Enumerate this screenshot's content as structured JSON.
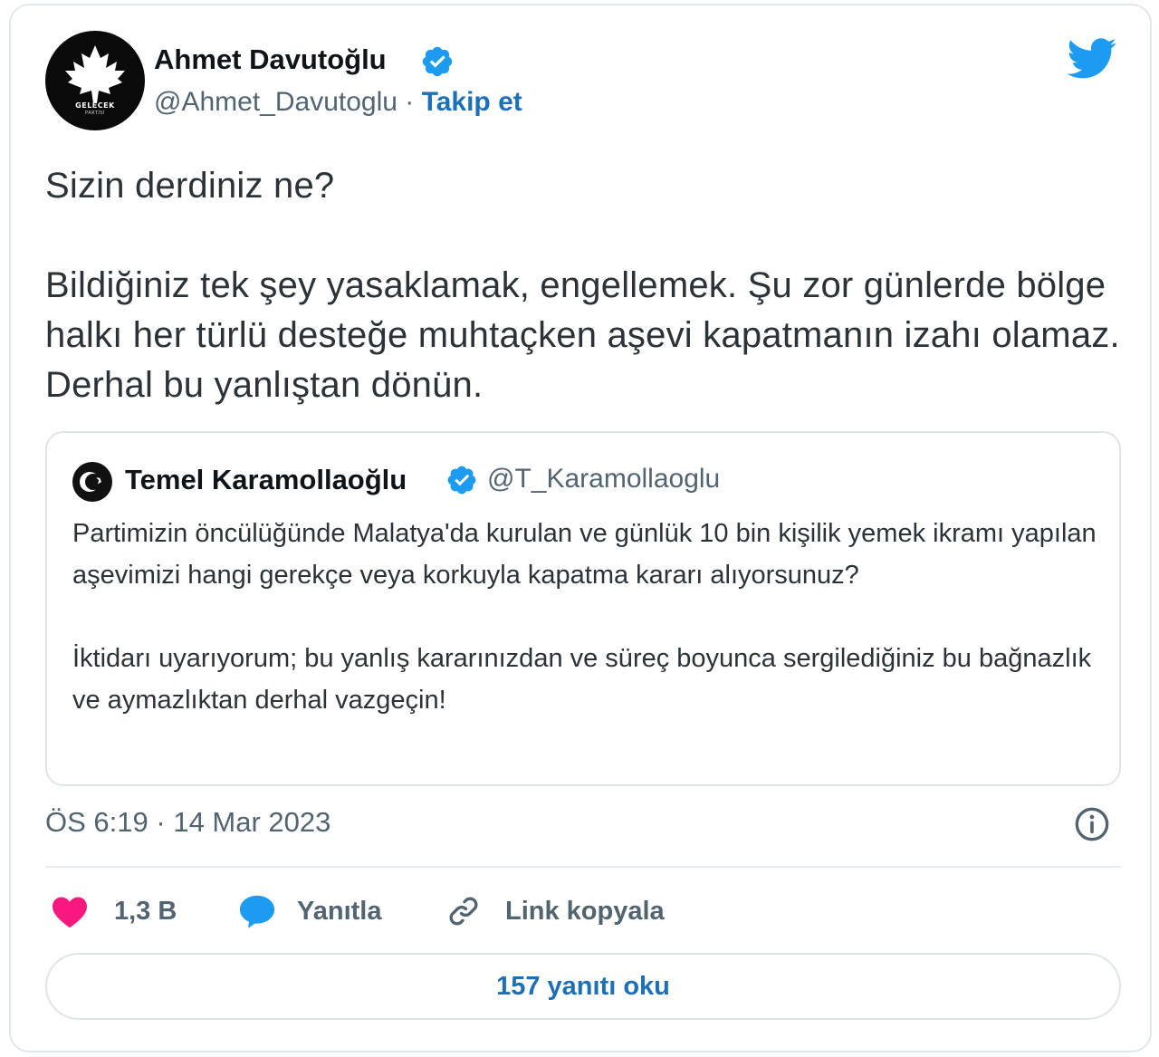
{
  "author": {
    "name": "Ahmet Davutoğlu",
    "handle": "@Ahmet_Davutoglu",
    "separator": "·",
    "follow_label": "Takip et",
    "avatar_text": "GELECEK",
    "avatar_subtext": "PARTİSİ",
    "avatar_icon": "maple-leaf-icon"
  },
  "tweet": {
    "paragraphs": [
      "Sizin derdiniz ne?",
      "Bildiğiniz tek şey yasaklamak, engellemek. Şu zor günlerde bölge halkı her türlü desteğe muhtaçken aşevi kapatmanın izahı olamaz. Derhal bu yanlıştan dönün."
    ]
  },
  "quote": {
    "name": "Temel Karamollaoğlu",
    "handle": "@T_Karamollaoglu",
    "paragraphs": [
      "Partimizin öncülüğünde Malatya'da kurulan ve günlük 10 bin kişilik yemek ikramı yapılan aşevimizi hangi gerekçe veya korkuyla kapatma kararı alıyorsunuz?",
      "İktidarı uyarıyorum; bu yanlış kararınızdan ve süreç boyunca sergilediğiniz bu bağnazlık ve aymazlıktan derhal vazgeçin!"
    ]
  },
  "meta": {
    "time": "ÖS 6:19",
    "separator": "·",
    "date": "14 Mar 2023"
  },
  "actions": {
    "like_count": "1,3 B",
    "reply_label": "Yanıtla",
    "copy_link_label": "Link kopyala"
  },
  "replies_button": "157 yanıtı oku",
  "colors": {
    "link_blue": "#1d70b8",
    "twitter_blue": "#1d9bf0",
    "like_pink": "#f91880",
    "muted": "#536471",
    "border": "#e1e8ed"
  }
}
